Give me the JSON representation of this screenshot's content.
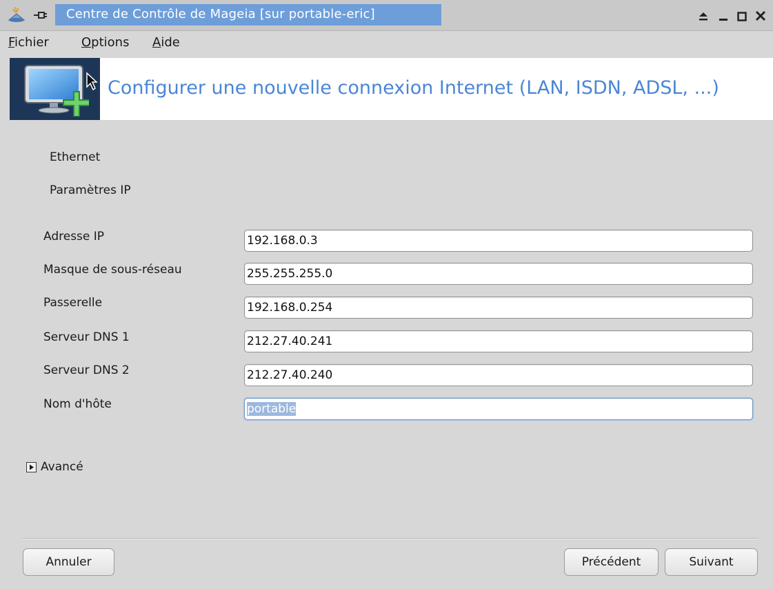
{
  "window": {
    "title": "Centre de Contrôle de Mageia  [sur portable-eric]",
    "controls": [
      "shade-icon",
      "minimize-icon",
      "maximize-icon",
      "close-icon"
    ]
  },
  "menu": {
    "items": [
      {
        "label": "Fichier",
        "mnemonic": "F",
        "rest": "ichier"
      },
      {
        "label": "Options",
        "mnemonic": "O",
        "rest": "ptions"
      },
      {
        "label": "Aide",
        "mnemonic": "A",
        "rest": "ide"
      }
    ]
  },
  "banner": {
    "icon": "network-monitor-icon",
    "title": "Configurer une nouvelle connexion Internet (LAN, ISDN, ADSL, ...)"
  },
  "content": {
    "connection_type": "Ethernet",
    "section_title": "Paramètres IP",
    "fields": [
      {
        "label": "Adresse IP",
        "value": "192.168.0.3"
      },
      {
        "label": "Masque de sous-réseau",
        "value": "255.255.255.0"
      },
      {
        "label": "Passerelle",
        "value": "192.168.0.254"
      },
      {
        "label": "Serveur DNS 1",
        "value": "212.27.40.241"
      },
      {
        "label": "Serveur DNS 2",
        "value": "212.27.40.240"
      },
      {
        "label": "Nom d'hôte",
        "value": "portable"
      }
    ],
    "advanced_label": "Avancé"
  },
  "buttons": {
    "cancel": "Annuler",
    "previous": "Précédent",
    "next": "Suivant"
  },
  "colors": {
    "title_highlight": "#6d9ed9",
    "banner_title": "#4a86d6",
    "selection": "#9db8de"
  }
}
